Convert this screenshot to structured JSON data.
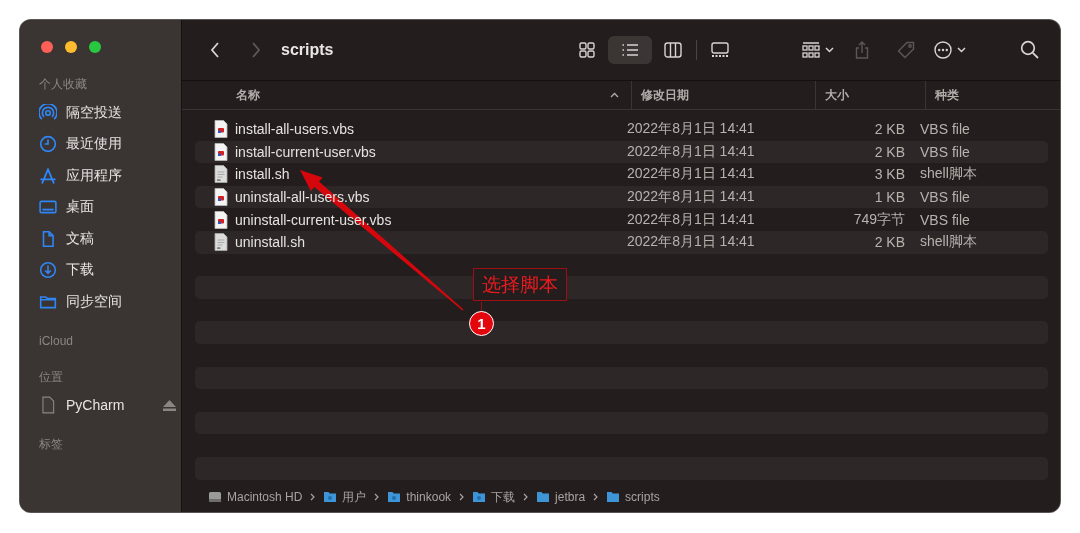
{
  "window": {
    "title": "scripts"
  },
  "sidebar": {
    "sections": [
      {
        "title": "个人收藏",
        "items": [
          {
            "label": "隔空投送",
            "kind": "airdrop"
          },
          {
            "label": "最近使用",
            "kind": "recents"
          },
          {
            "label": "应用程序",
            "kind": "apps"
          },
          {
            "label": "桌面",
            "kind": "desktop"
          },
          {
            "label": "文稿",
            "kind": "documents"
          },
          {
            "label": "下载",
            "kind": "downloads"
          },
          {
            "label": "同步空间",
            "kind": "folder"
          }
        ]
      },
      {
        "title": "iCloud"
      },
      {
        "title": "位置",
        "items": [
          {
            "label": "PyCharm",
            "kind": "drive",
            "ejectable": true
          }
        ]
      },
      {
        "title": "标签"
      }
    ]
  },
  "toolbar": {
    "back": {
      "disabled": false
    },
    "forward": {
      "disabled": true
    },
    "view_modes": [
      {
        "kind": "icons",
        "selected": false
      },
      {
        "kind": "list",
        "selected": true
      },
      {
        "kind": "columns",
        "selected": false
      },
      {
        "kind": "gallery",
        "selected": false
      }
    ],
    "actions": [
      {
        "kind": "group",
        "disabled": false
      },
      {
        "kind": "share",
        "disabled": true
      },
      {
        "kind": "tag",
        "disabled": true
      },
      {
        "kind": "more",
        "disabled": false
      }
    ]
  },
  "columns": [
    {
      "label": "名称",
      "sorted": true
    },
    {
      "label": "修改日期",
      "sorted": false
    },
    {
      "label": "大小",
      "sorted": false
    },
    {
      "label": "种类",
      "sorted": false
    }
  ],
  "rows": [
    {
      "name": "install-all-users.vbs",
      "kind": "vbs",
      "modified": "2022年8月1日 14:41",
      "size": "2 KB",
      "type": "VBS file"
    },
    {
      "name": "install-current-user.vbs",
      "kind": "vbs",
      "modified": "2022年8月1日 14:41",
      "size": "2 KB",
      "type": "VBS file"
    },
    {
      "name": "install.sh",
      "kind": "sh",
      "modified": "2022年8月1日 14:41",
      "size": "3 KB",
      "type": "shell脚本"
    },
    {
      "name": "uninstall-all-users.vbs",
      "kind": "vbs",
      "modified": "2022年8月1日 14:41",
      "size": "1 KB",
      "type": "VBS file"
    },
    {
      "name": "uninstall-current-user.vbs",
      "kind": "vbs",
      "modified": "2022年8月1日 14:41",
      "size": "749字节",
      "type": "VBS file"
    },
    {
      "name": "uninstall.sh",
      "kind": "sh",
      "modified": "2022年8月1日 14:41",
      "size": "2 KB",
      "type": "shell脚本"
    }
  ],
  "path_bar": [
    {
      "label": "Macintosh HD",
      "kind": "disk"
    },
    {
      "label": "用户",
      "kind": "users"
    },
    {
      "label": "thinkook",
      "kind": "home"
    },
    {
      "label": "下载",
      "kind": "downloads"
    },
    {
      "label": "jetbra",
      "kind": "folder"
    },
    {
      "label": "scripts",
      "kind": "folder"
    }
  ],
  "annotation": {
    "label": "选择脚本",
    "step": "1"
  }
}
